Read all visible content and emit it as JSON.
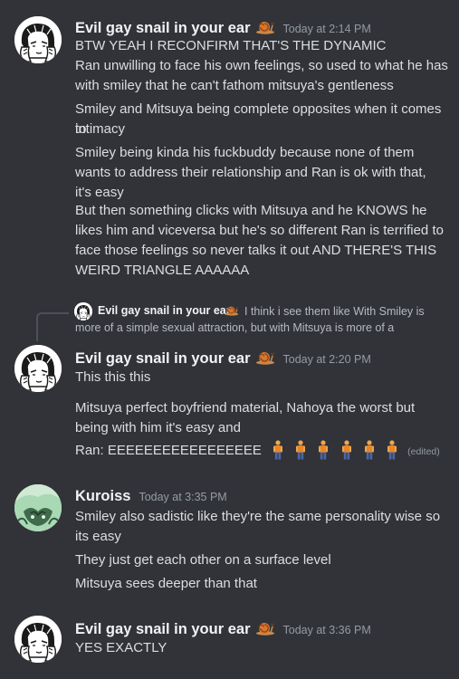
{
  "colors": {
    "background": "#313338",
    "username": "#f2f3f5",
    "message_text": "#dbdee1",
    "timestamp": "#949ba4",
    "reply_text": "#b5bac1"
  },
  "messages": [
    {
      "author": "Evil gay snail in your ear",
      "author_emoji": "snail-icon",
      "timestamp": "Today at 2:14 PM",
      "lines": [
        "BTW YEAH I RECONFIRM THAT'S THE DYNAMIC",
        "Ran unwilling to face his own feelings, so used to what he has",
        "with smiley that he can't fathom mitsuya's gentleness",
        "Smiley and Mitsuya being complete opposites when it comes to",
        "intimacy",
        "Smiley being kinda his fuckbuddy because  none of them",
        "wants to address their relationship and Ran is ok with that,",
        "it's easy",
        "But then something clicks with Mitsuya and he KNOWS he",
        "likes him and viceversa but he's so different Ran is terrified to",
        "face those feelings so never talks it out AND THERE'S THIS",
        "WEIRD TRIANGLE AAAAAA"
      ]
    },
    {
      "reply": {
        "author": "Evil gay snail in your ear",
        "text_line1": "I think i see them like  With Smiley is",
        "text_line2": "more of a simple sexual attraction, but with Mitsuya is more of a"
      },
      "author": "Evil gay snail in your ear",
      "author_emoji": "snail-icon",
      "timestamp": "Today at 2:20 PM",
      "lines": [
        "This this this",
        "Mitsuya perfect boyfriend material, Nahoya the worst but",
        "being with him it's easy and",
        "Ran: EEEEEEEEEEEEEEEEE"
      ],
      "trailing_emojis": [
        "person-standing-icon",
        "person-standing-icon",
        "person-standing-icon",
        "person-standing-icon",
        "person-standing-icon",
        "person-standing-icon"
      ],
      "edited_label": "(edited)"
    },
    {
      "author": "Kuroiss",
      "timestamp": "Today at 3:35 PM",
      "lines": [
        "Smiley also sadistic like they're the same personality wise so",
        "its easy",
        "They just get each other on a surface level",
        "Mitsuya sees deeper than that"
      ]
    },
    {
      "author": "Evil gay snail in your ear",
      "author_emoji": "snail-icon",
      "timestamp": "Today at 3:36 PM",
      "lines": [
        "YES EXACTLY"
      ]
    }
  ]
}
